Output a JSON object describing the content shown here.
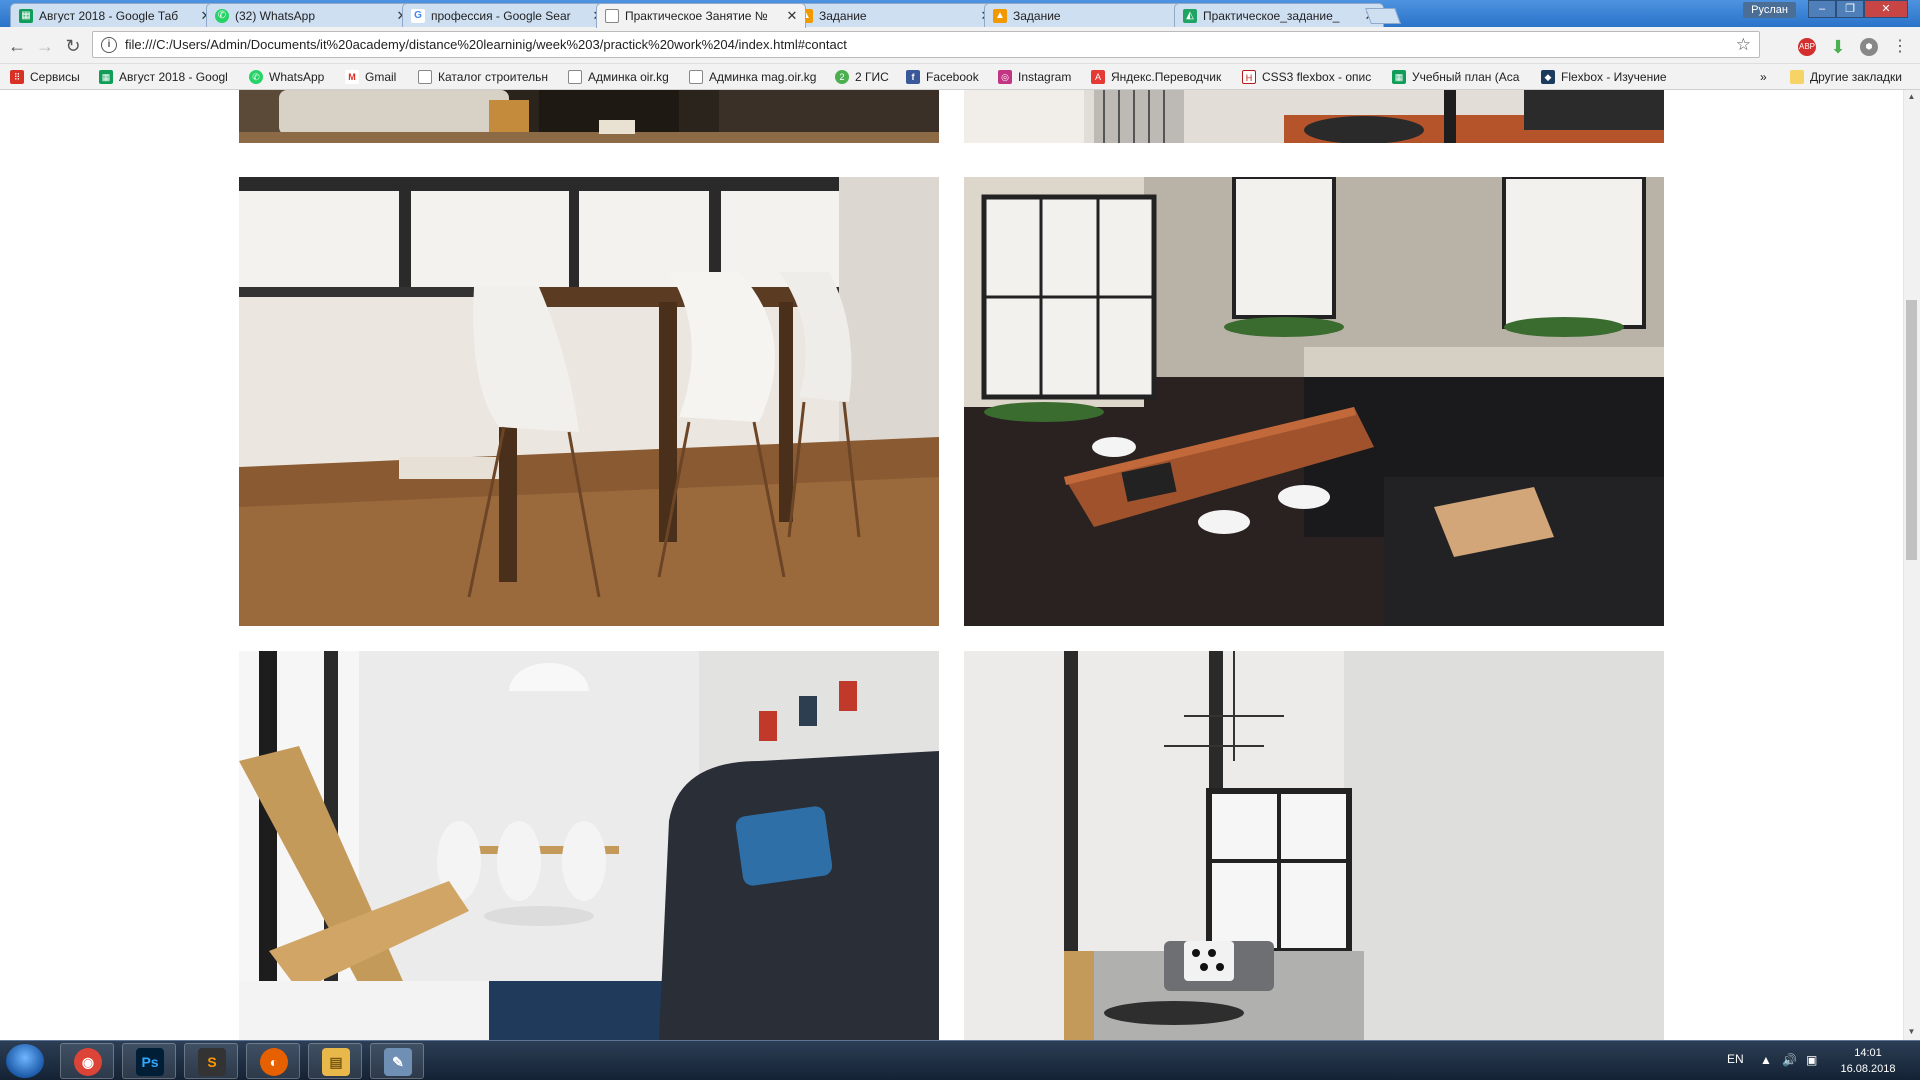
{
  "browser": {
    "tabs": [
      {
        "label": "Август 2018 - Google Таб",
        "favicon": "sheets-icon",
        "color": "#0f9d58",
        "active": false
      },
      {
        "label": "(32) WhatsApp",
        "favicon": "whatsapp-icon",
        "color": "#25d366",
        "active": false
      },
      {
        "label": "профессия - Google Sear",
        "favicon": "google-icon",
        "color": "#4285f4",
        "active": false
      },
      {
        "label": "Практическое Занятие №",
        "favicon": "file-icon",
        "color": "#888888",
        "active": true
      },
      {
        "label": "Задание",
        "favicon": "classroom-icon",
        "color": "#f29900",
        "active": false
      },
      {
        "label": "Задание",
        "favicon": "classroom-icon",
        "color": "#f29900",
        "active": false
      },
      {
        "label": "Практическое_задание_",
        "favicon": "drive-icon",
        "color": "#1fa463",
        "active": false
      }
    ],
    "profile_name": "Руслан",
    "address": "file:///C:/Users/Admin/Documents/it%20academy/distance%20learninig/week%203/practick%20work%204/index.html#contact",
    "bookmarks": [
      {
        "label": "Сервисы",
        "icon": "apps-grid-icon",
        "color": "#d93025"
      },
      {
        "label": "Август 2018 - Googl",
        "icon": "sheets-icon",
        "color": "#0f9d58"
      },
      {
        "label": "WhatsApp",
        "icon": "whatsapp-icon",
        "color": "#25d366"
      },
      {
        "label": "Gmail",
        "icon": "gmail-icon",
        "color": "#d93025"
      },
      {
        "label": "Каталог строительн",
        "icon": "file-icon",
        "color": "#888888"
      },
      {
        "label": "Админка oir.kg",
        "icon": "file-icon",
        "color": "#888888"
      },
      {
        "label": "Админка mag.oir.kg",
        "icon": "file-icon",
        "color": "#888888"
      },
      {
        "label": "2 ГИС",
        "icon": "2gis-icon",
        "color": "#4caf50"
      },
      {
        "label": "Facebook",
        "icon": "facebook-icon",
        "color": "#3b5998"
      },
      {
        "label": "Instagram",
        "icon": "instagram-icon",
        "color": "#c13584"
      },
      {
        "label": "Яндекс.Переводчик",
        "icon": "yandex-translate-icon",
        "color": "#e53935"
      },
      {
        "label": "CSS3 flexbox - опис",
        "icon": "htmlbook-icon",
        "color": "#b71c1c"
      },
      {
        "label": "Учебный план (Aca",
        "icon": "sheets-icon",
        "color": "#0f9d58"
      },
      {
        "label": "Flexbox - Изучение",
        "icon": "mdn-icon",
        "color": "#1a3b5c"
      }
    ],
    "bookmarks_overflow": "»",
    "other_bookmarks": "Другие закладки"
  },
  "page": {
    "gallery": [
      {
        "name": "photo-living-room-sofa",
        "colors": [
          "#3a2e24",
          "#8c6a45",
          "#d8cfc2"
        ]
      },
      {
        "name": "photo-bedroom-rug",
        "colors": [
          "#d9d4cd",
          "#a0522d",
          "#2a2a2a"
        ]
      },
      {
        "name": "photo-dining-table-white-chairs",
        "colors": [
          "#e9e4dd",
          "#8a5a32",
          "#5b3b22"
        ]
      },
      {
        "name": "photo-loft-kitchen-brick",
        "colors": [
          "#c9c3b8",
          "#3d2f2a",
          "#1d1d1f"
        ]
      },
      {
        "name": "photo-living-room-dark-sofa",
        "colors": [
          "#e8e8e8",
          "#2a2e36",
          "#c49a5a"
        ]
      },
      {
        "name": "photo-white-room-window",
        "colors": [
          "#e6e6e4",
          "#d5d5d3",
          "#3a3a3a"
        ]
      }
    ]
  },
  "taskbar": {
    "apps": [
      {
        "name": "chrome-taskbar-icon",
        "glyph": "◉",
        "color": "#db4437"
      },
      {
        "name": "photoshop-taskbar-icon",
        "glyph": "Ps",
        "color": "#001e36"
      },
      {
        "name": "sublime-taskbar-icon",
        "glyph": "S",
        "color": "#ff9800"
      },
      {
        "name": "firefox-taskbar-icon",
        "glyph": "◐",
        "color": "#e66000"
      },
      {
        "name": "explorer-taskbar-icon",
        "glyph": "▤",
        "color": "#e8b84a"
      },
      {
        "name": "paint-taskbar-icon",
        "glyph": "✎",
        "color": "#6f8fb5"
      }
    ],
    "language": "EN",
    "time": "14:01",
    "date": "16.08.2018"
  }
}
